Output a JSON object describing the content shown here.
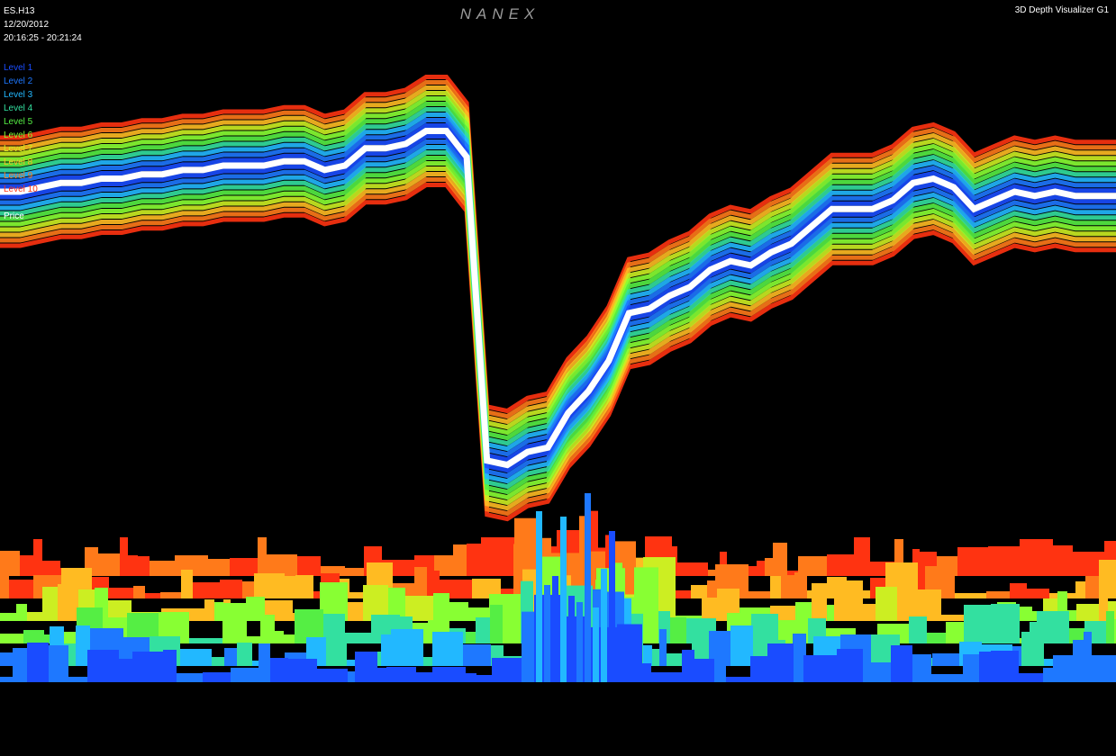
{
  "header": {
    "symbol": "ES.H13",
    "date": "12/20/2012",
    "time_range": "20:16:25 - 20:21:24",
    "brand": "NANEX",
    "app_title": "3D Depth Visualizer G1"
  },
  "legend": {
    "items": [
      {
        "label": "Level 1",
        "color": "#1a4cff"
      },
      {
        "label": "Level 2",
        "color": "#1e78ff"
      },
      {
        "label": "Level 3",
        "color": "#22b8ff"
      },
      {
        "label": "Level 4",
        "color": "#33e0a0"
      },
      {
        "label": "Level 5",
        "color": "#55ee44"
      },
      {
        "label": "Level 6",
        "color": "#88ff33"
      },
      {
        "label": "Level 7",
        "color": "#ccee22"
      },
      {
        "label": "Level 8",
        "color": "#ffbb22"
      },
      {
        "label": "Level 9",
        "color": "#ff7a1a"
      },
      {
        "label": "Level 10",
        "color": "#ff3311"
      }
    ],
    "price_label": "Price",
    "price_color": "#ffffff"
  },
  "chart_data": {
    "type": "area",
    "title": "",
    "xlabel": "",
    "ylabel": "",
    "series": [
      {
        "name": "Price",
        "values": [
          72,
          72,
          73,
          74,
          74,
          75,
          75,
          76,
          76,
          77,
          77,
          78,
          78,
          78,
          79,
          79,
          77,
          78,
          82,
          82,
          83,
          86,
          86,
          80,
          10,
          9,
          12,
          13,
          21,
          26,
          33,
          44,
          45,
          48,
          50,
          54,
          56,
          55,
          58,
          60,
          64,
          68,
          68,
          68,
          70,
          74,
          75,
          73,
          68,
          70,
          72,
          71,
          72,
          71,
          71,
          71
        ]
      }
    ],
    "depth_levels": 10,
    "grid": false
  }
}
